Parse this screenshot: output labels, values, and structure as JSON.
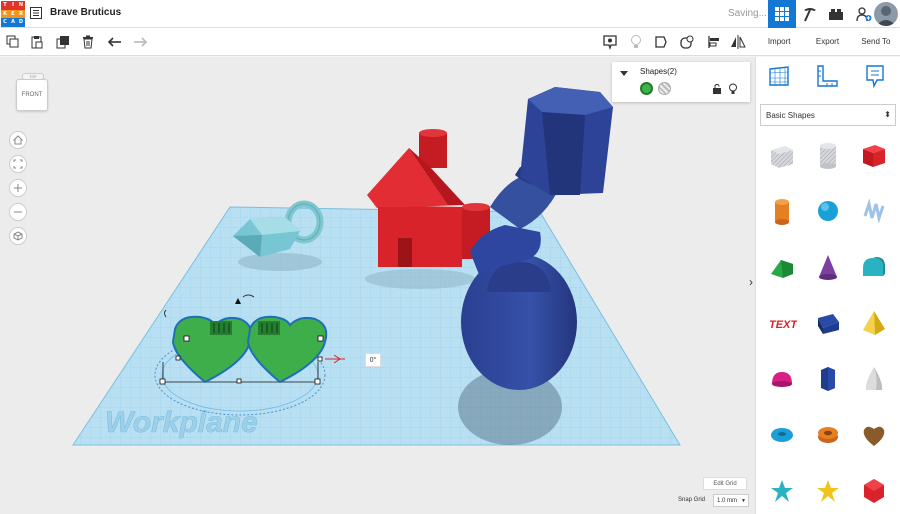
{
  "app": {
    "logo_letters": [
      "T",
      "I",
      "N",
      "K",
      "E",
      "R",
      "C",
      "A",
      "D"
    ],
    "logo_colors": [
      "#e2332a",
      "#e2332a",
      "#e2332a",
      "#f6921e",
      "#f6921e",
      "#f6921e",
      "#1477d4",
      "#1477d4",
      "#1477d4"
    ],
    "design_title": "Brave Bruticus",
    "save_status": "Saving...",
    "accent_color": "#1477d4"
  },
  "header_icons": [
    "grid-view-icon",
    "pickaxe-icon",
    "brick-icon",
    "add-user-icon",
    "avatar"
  ],
  "toolbar": {
    "left_tools": [
      "copy-icon",
      "paste-icon",
      "duplicate-icon",
      "delete-icon",
      "undo-icon",
      "redo-icon"
    ],
    "right_tools": [
      "note-icon",
      "light-bulb-icon",
      "shape-solid-icon",
      "shape-hole-icon",
      "align-icon",
      "mirror-icon"
    ]
  },
  "actions": {
    "import": "Import",
    "export": "Export",
    "send_to": "Send To"
  },
  "viewcube": {
    "top_label": "TOP",
    "front_label": "FRONT"
  },
  "nav_controls": [
    "home-icon",
    "fit-view-icon",
    "zoom-in-icon",
    "zoom-out-icon",
    "orthographic-icon"
  ],
  "shapes_panel": {
    "title": "Shapes(2)"
  },
  "workplane": {
    "label": "Workplane",
    "rotation_readout": "0°",
    "edit_grid": "Edit Grid",
    "snap_grid_label": "Snap Grid",
    "snap_grid_value": "1.0 mm"
  },
  "library": {
    "category_icons": [
      "workplane-icon",
      "ruler-icon",
      "notes-icon"
    ],
    "selected": "Basic Shapes",
    "shapes": [
      {
        "name": "box-hole",
        "color": "#b9bcc2"
      },
      {
        "name": "cylinder-hole",
        "color": "#b9bcc2"
      },
      {
        "name": "box",
        "color": "#d8232a"
      },
      {
        "name": "cylinder",
        "color": "#e67e22"
      },
      {
        "name": "sphere",
        "color": "#1a9fd8"
      },
      {
        "name": "scribble",
        "color": "#9dc3e6"
      },
      {
        "name": "roof",
        "color": "#27a844"
      },
      {
        "name": "cone",
        "color": "#7a3fa0"
      },
      {
        "name": "round-roof",
        "color": "#29b2c1"
      },
      {
        "name": "text",
        "color": "#d8232a"
      },
      {
        "name": "wedge",
        "color": "#1f3d8f"
      },
      {
        "name": "pyramid",
        "color": "#f0c419"
      },
      {
        "name": "half-sphere",
        "color": "#d91e84"
      },
      {
        "name": "polygon",
        "color": "#1f3d8f"
      },
      {
        "name": "paraboloid",
        "color": "#d0d0d0"
      },
      {
        "name": "torus",
        "color": "#1a9fd8"
      },
      {
        "name": "tube",
        "color": "#e67e22"
      },
      {
        "name": "heart",
        "color": "#8b5a2b"
      },
      {
        "name": "star",
        "color": "#29b2c1"
      },
      {
        "name": "star-gold",
        "color": "#f0c419"
      },
      {
        "name": "polyhedron",
        "color": "#d8232a"
      }
    ]
  }
}
